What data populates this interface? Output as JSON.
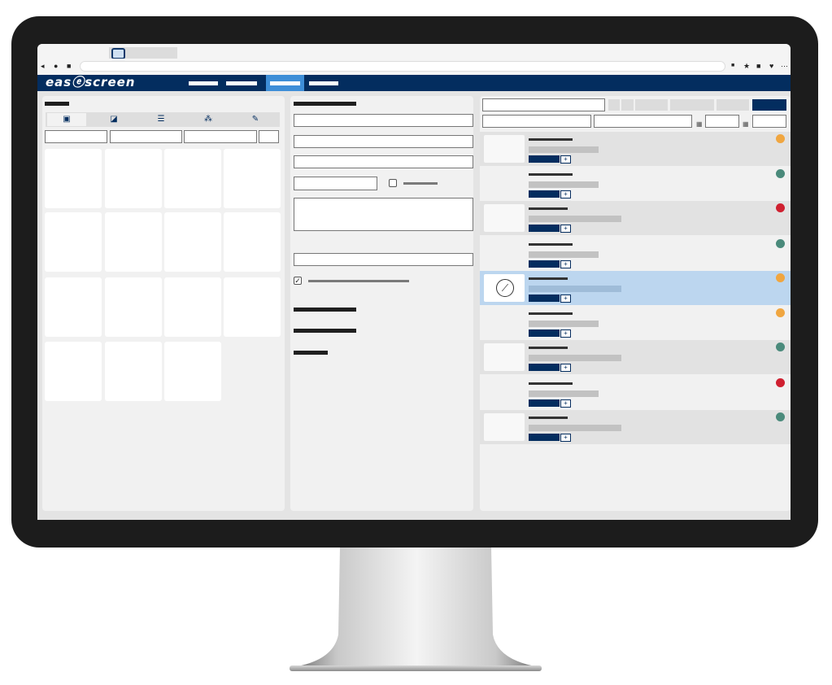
{
  "app": {
    "brand": "easⓔscreen",
    "accent_color": "#032d5f",
    "highlight_color": "#3e8ed7"
  },
  "browser": {
    "nav_icons": [
      "back-icon",
      "forward-icon",
      "home-icon"
    ],
    "extension_icons": [
      "extension-icon",
      "star-icon",
      "puzzle-icon",
      "heart-icon",
      "menu-icon"
    ]
  },
  "left_panel": {
    "toolbar_icons": [
      "import-icon",
      "chart-icon",
      "list-icon",
      "share-icon",
      "tool-icon"
    ]
  },
  "right_panel": {
    "status_colors": {
      "orange": "#f0a640",
      "green": "#4a8a7b",
      "red": "#cf2030"
    },
    "rows": [
      {
        "status": "orange",
        "selected": false
      },
      {
        "status": "green",
        "selected": false
      },
      {
        "status": "red",
        "selected": false
      },
      {
        "status": "green",
        "selected": false
      },
      {
        "status": "orange",
        "selected": true
      },
      {
        "status": "orange",
        "selected": false
      },
      {
        "status": "green",
        "selected": false
      },
      {
        "status": "red",
        "selected": false
      },
      {
        "status": "green",
        "selected": false
      }
    ]
  }
}
